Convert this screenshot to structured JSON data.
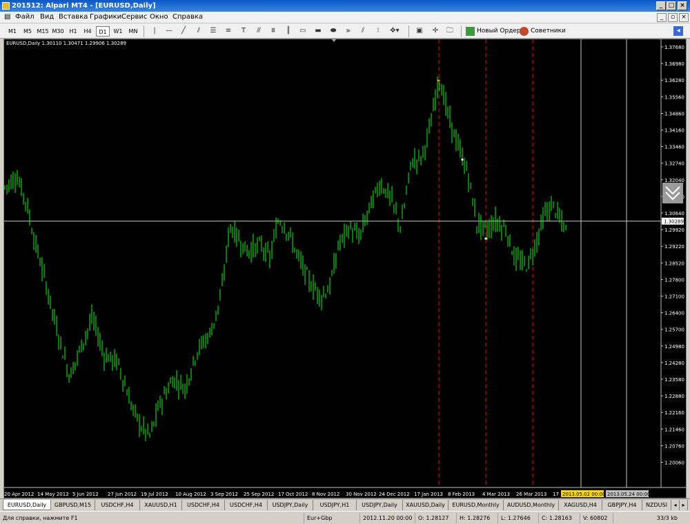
{
  "window": {
    "title": "201512: Alpari MT4 - [EURUSD,Daily]"
  },
  "menu": [
    "Файл",
    "Вид",
    "Вставка",
    "Графики",
    "Сервис",
    "Окно",
    "Справка"
  ],
  "timeframes": [
    "M1",
    "M5",
    "M15",
    "M30",
    "H1",
    "H4",
    "D1",
    "W1",
    "MN"
  ],
  "selected_timeframe": "D1",
  "toolbar": {
    "new_order": "Новый Ордер",
    "advisors": "Советники"
  },
  "chart": {
    "symbol_line": "EURUSD,Daily  1.30110 1.30471 1.29906 1.30289",
    "price_labels": [
      "1.37680",
      "1.36980",
      "1.36280",
      "1.35560",
      "1.34860",
      "1.34160",
      "1.33460",
      "1.32740",
      "1.32040",
      "1.31340",
      "1.30640",
      "1.29920",
      "1.29220",
      "1.28520",
      "1.27800",
      "1.27100",
      "1.26400",
      "1.25700",
      "1.24980",
      "1.24280",
      "1.23580",
      "1.22880",
      "1.22160",
      "1.21460",
      "1.20760",
      "1.20060"
    ],
    "current_price": "1.30289",
    "date_labels": [
      "20 Apr 2012",
      "14 May 2012",
      "5 Jun 2012",
      "27 Jun 2012",
      "19 Jul 2012",
      "10 Aug 2012",
      "3 Sep 2012",
      "25 Sep 2012",
      "17 Oct 2012",
      "8 Nov 2012",
      "30 Nov 2012",
      "24 Dec 2012",
      "17 Jan 2013",
      "8 Feb 2013",
      "4 Mar 2013",
      "26 Mar 2013",
      "17"
    ],
    "future_dates": [
      "2013.05.02 00:00",
      "2013.05.24 00:00"
    ],
    "colors": {
      "candles": "#00ff00",
      "background": "#000000",
      "vlines": "#ff0000"
    }
  },
  "tabs": [
    "EURUSD,Daily",
    "GBPUSD,M15",
    "USDCHF,H4",
    "XAUUSD,H1",
    "USDCHF,H4",
    "USDCHF,H4",
    "USDJPY,Daily",
    "USDJPY,H1",
    "USDJPY,Daily",
    "XAUUSD,Daily",
    "EURUSD,Monthly",
    "AUDUSD,Monthly",
    "XAGUSD,H4",
    "GBPJPY,H4",
    "NZDUSI"
  ],
  "status": {
    "help": "Для справки, нажмите F1",
    "profile": "Eur+Gbp",
    "datetime": "2012.11.20 00:00",
    "open": "O: 1.28127",
    "high": "H: 1.28276",
    "low": "L: 1.27646",
    "close": "C: 1.28163",
    "volume": "V: 60802",
    "traffic": "33/3 kb"
  }
}
